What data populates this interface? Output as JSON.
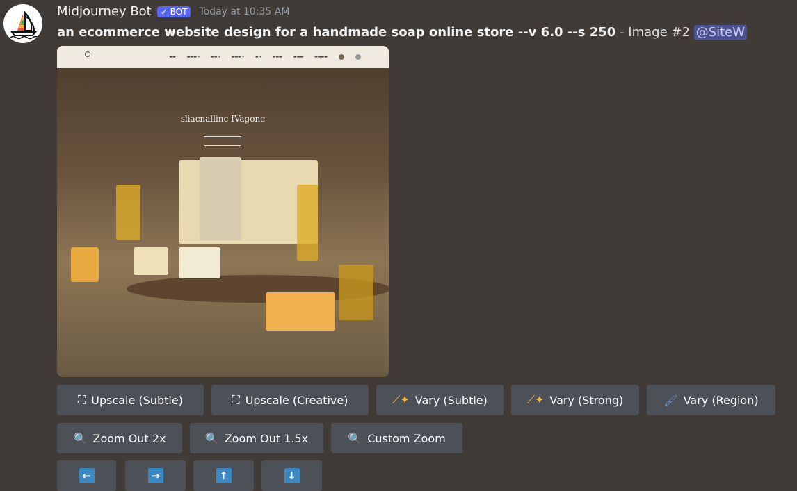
{
  "message": {
    "author": "Midjourney Bot",
    "badge": "BOT",
    "timestamp": "Today at 10:35 AM",
    "prompt": "an ecommerce website design for a handmade soap online store --v 6.0 --s 250",
    "suffix": " - Image #2 ",
    "mention": "@SiteW",
    "image": {
      "hero_title": "sliacnallinc IVagone"
    }
  },
  "buttons": {
    "row1": [
      {
        "label": "Upscale (Subtle)",
        "icon": "expand-icon"
      },
      {
        "label": "Upscale (Creative)",
        "icon": "expand-icon"
      },
      {
        "label": "Vary (Subtle)",
        "icon": "magic-wand-icon"
      },
      {
        "label": "Vary (Strong)",
        "icon": "magic-wand-icon"
      },
      {
        "label": "Vary (Region)",
        "icon": "paintbrush-icon"
      }
    ],
    "row2": [
      {
        "label": "Zoom Out 2x",
        "icon": "magnifier-icon"
      },
      {
        "label": "Zoom Out 1.5x",
        "icon": "magnifier-icon"
      },
      {
        "label": "Custom Zoom",
        "icon": "magnifier-icon"
      }
    ],
    "row3": [
      {
        "icon": "arrow-left-icon"
      },
      {
        "icon": "arrow-right-icon"
      },
      {
        "icon": "arrow-up-icon"
      },
      {
        "icon": "arrow-down-icon"
      }
    ]
  },
  "colors": {
    "background": "#403b36",
    "button": "#4e5058",
    "bot_badge": "#5865f2",
    "arrow": "#3b88c3"
  }
}
